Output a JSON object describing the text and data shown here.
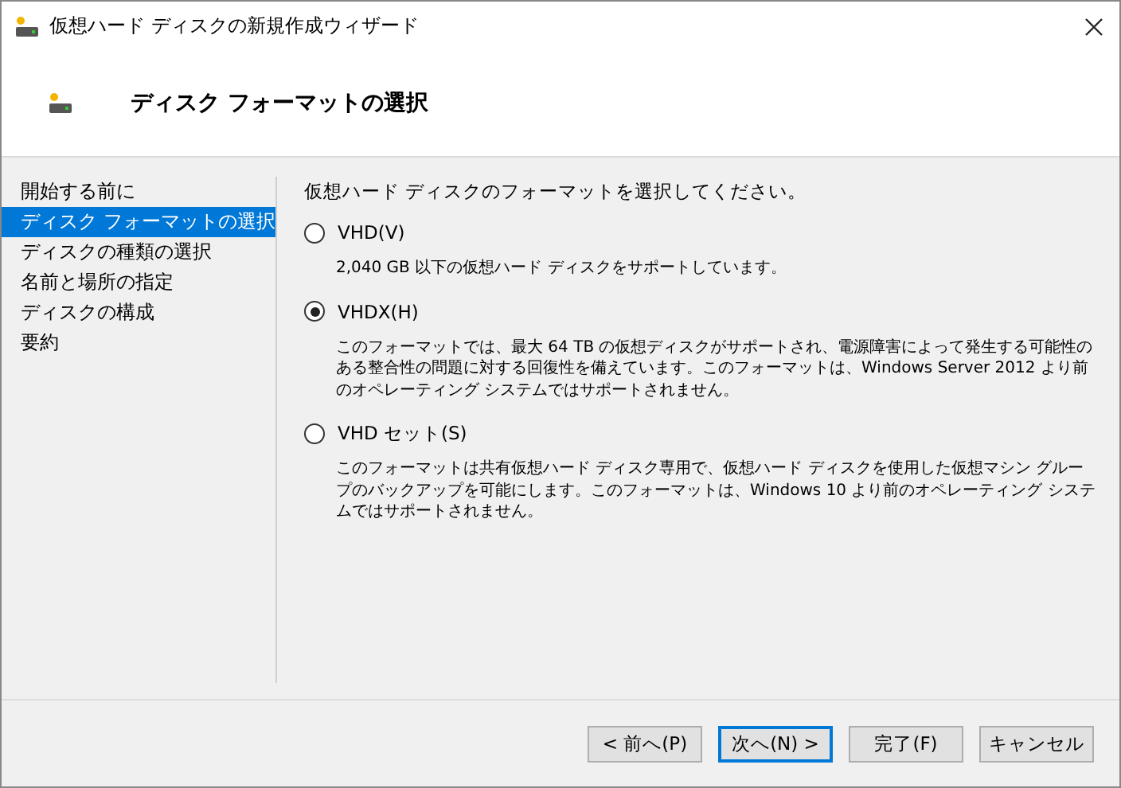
{
  "window": {
    "title": "仮想ハード ディスクの新規作成ウィザード"
  },
  "header": {
    "title": "ディスク フォーマットの選択"
  },
  "sidebar": {
    "items": [
      {
        "label": "開始する前に",
        "selected": false
      },
      {
        "label": "ディスク フォーマットの選択",
        "selected": true
      },
      {
        "label": "ディスクの種類の選択",
        "selected": false
      },
      {
        "label": "名前と場所の指定",
        "selected": false
      },
      {
        "label": "ディスクの構成",
        "selected": false
      },
      {
        "label": "要約",
        "selected": false
      }
    ]
  },
  "content": {
    "prompt": "仮想ハード ディスクのフォーマットを選択してください。",
    "options": [
      {
        "label": "VHD(V)",
        "selected": false,
        "description": "2,040 GB 以下の仮想ハード ディスクをサポートしています。"
      },
      {
        "label": "VHDX(H)",
        "selected": true,
        "description": "このフォーマットでは、最大 64 TB の仮想ディスクがサポートされ、電源障害によって発生する可能性のある整合性の問題に対する回復性を備えています。このフォーマットは、Windows Server 2012 より前のオペレーティング システムではサポートされません。"
      },
      {
        "label": "VHD セット(S)",
        "selected": false,
        "description": "このフォーマットは共有仮想ハード ディスク専用で、仮想ハード ディスクを使用した仮想マシン グループのバックアップを可能にします。このフォーマットは、Windows 10 より前のオペレーティング システムではサポートされません。"
      }
    ]
  },
  "buttons": [
    {
      "label": "< 前へ(P)",
      "default": false
    },
    {
      "label": "次へ(N) >",
      "default": true
    },
    {
      "label": "完了(F)",
      "default": false
    },
    {
      "label": "キャンセル",
      "default": false
    }
  ]
}
